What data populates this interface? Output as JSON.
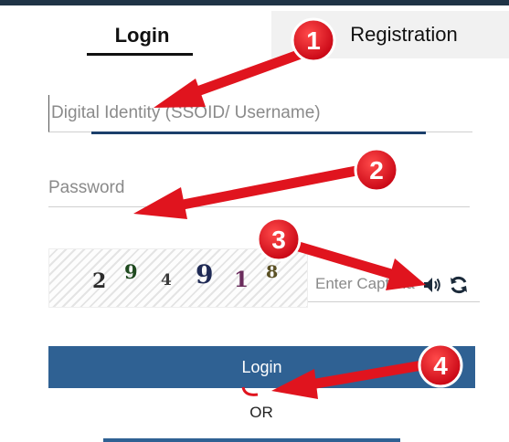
{
  "tabs": {
    "login_label": "Login",
    "registration_label": "Registration"
  },
  "form": {
    "username_placeholder": "Digital Identity (SSOID/ Username)",
    "password_placeholder": "Password",
    "captcha_digits": [
      "2",
      "9",
      "4",
      "9",
      "1",
      "8"
    ],
    "captcha_placeholder": "Enter Captcha",
    "speaker_icon": "speaker-icon",
    "refresh_icon": "refresh-icon",
    "login_button": "Login",
    "or_text": "OR"
  },
  "annotations": {
    "markers": [
      "1",
      "2",
      "3",
      "4"
    ],
    "marker_color": "#e0141e",
    "arrow_color": "#e0141e"
  },
  "colors": {
    "primary_button": "#2f6193",
    "top_bar": "#1f3446",
    "focus_line": "#1b3f6b"
  }
}
